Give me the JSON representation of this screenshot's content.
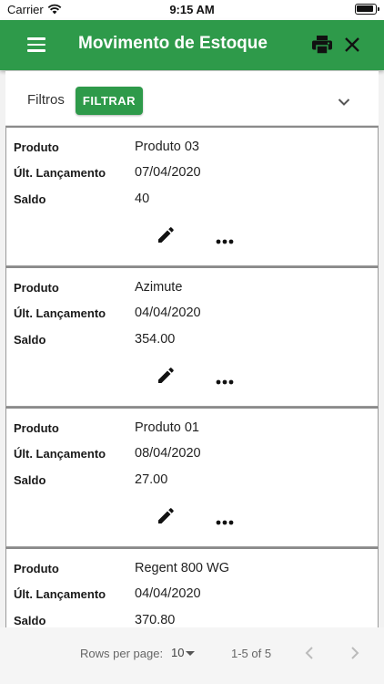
{
  "status_bar": {
    "carrier": "Carrier",
    "time": "9:15 AM"
  },
  "app_bar": {
    "title": "Movimento de Estoque",
    "menu_icon": "menu-icon",
    "print_icon": "print-icon",
    "close_icon": "close-icon",
    "color": "#2e9a4a"
  },
  "filters": {
    "label": "Filtros",
    "button_label": "FILTRAR",
    "chevron_icon": "chevron-down-icon"
  },
  "cards": [
    {
      "produto_label": "Produto",
      "produto": "Produto 03",
      "lancamento_label": "Últ. Lançamento",
      "lancamento": "07/04/2020",
      "saldo_label": "Saldo",
      "saldo": "40"
    },
    {
      "produto_label": "Produto",
      "produto": "Azimute",
      "lancamento_label": "Últ. Lançamento",
      "lancamento": "04/04/2020",
      "saldo_label": "Saldo",
      "saldo": "354.00"
    },
    {
      "produto_label": "Produto",
      "produto": "Produto 01",
      "lancamento_label": "Últ. Lançamento",
      "lancamento": "08/04/2020",
      "saldo_label": "Saldo",
      "saldo": "27.00"
    },
    {
      "produto_label": "Produto",
      "produto": "Regent 800 WG",
      "lancamento_label": "Últ. Lançamento",
      "lancamento": "04/04/2020",
      "saldo_label": "Saldo",
      "saldo": "370.80"
    }
  ],
  "pagination": {
    "rows_per_page_label": "Rows per page:",
    "rows_per_page_value": "10",
    "page_info": "1-5 of 5"
  }
}
